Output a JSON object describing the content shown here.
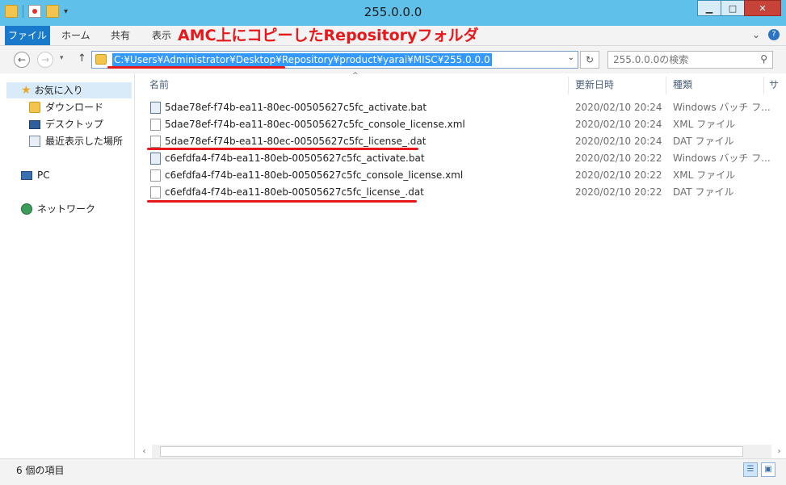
{
  "window": {
    "title": "255.0.0.0"
  },
  "ribbon": {
    "tabs": [
      "ファイル",
      "ホーム",
      "共有",
      "表示"
    ],
    "annotation": "AMC上にコピーしたRepositoryフォルダ"
  },
  "nav": {
    "address": "C:¥Users¥Administrator¥Desktop¥Repository¥product¥yarai¥MISC¥255.0.0.0",
    "search_placeholder": "255.0.0.0の検索"
  },
  "sidebar": {
    "items": [
      {
        "label": "お気に入り",
        "icon": "star-icon"
      },
      {
        "label": "ダウンロード",
        "icon": "download-folder-icon"
      },
      {
        "label": "デスクトップ",
        "icon": "desktop-icon"
      },
      {
        "label": "最近表示した場所",
        "icon": "recent-places-icon"
      },
      {
        "label": "PC",
        "icon": "pc-icon"
      },
      {
        "label": "ネットワーク",
        "icon": "network-icon"
      }
    ]
  },
  "columns": {
    "name": "名前",
    "modified": "更新日時",
    "type": "種類",
    "size": "サ"
  },
  "files": [
    {
      "name": "5dae78ef-f74b-ea11-80ec-00505627c5fc_activate.bat",
      "date": "2020/02/10 20:24",
      "type": "Windows バッチ フ...",
      "icon": "batch-file-icon"
    },
    {
      "name": "5dae78ef-f74b-ea11-80ec-00505627c5fc_console_license.xml",
      "date": "2020/02/10 20:24",
      "type": "XML ファイル",
      "icon": "file-icon"
    },
    {
      "name": "5dae78ef-f74b-ea11-80ec-00505627c5fc_license_.dat",
      "date": "2020/02/10 20:24",
      "type": "DAT ファイル",
      "icon": "file-icon"
    },
    {
      "name": "c6efdfa4-f74b-ea11-80eb-00505627c5fc_activate.bat",
      "date": "2020/02/10 20:22",
      "type": "Windows バッチ フ...",
      "icon": "batch-file-icon"
    },
    {
      "name": "c6efdfa4-f74b-ea11-80eb-00505627c5fc_console_license.xml",
      "date": "2020/02/10 20:22",
      "type": "XML ファイル",
      "icon": "file-icon"
    },
    {
      "name": "c6efdfa4-f74b-ea11-80eb-00505627c5fc_license_.dat",
      "date": "2020/02/10 20:22",
      "type": "DAT ファイル",
      "icon": "file-icon"
    }
  ],
  "status": {
    "count": "6 個の項目"
  },
  "colors": {
    "annotation": "#e5191c",
    "titlebar": "#5fc0ea",
    "file_tab": "#1979ca",
    "selection": "#3399ff"
  }
}
